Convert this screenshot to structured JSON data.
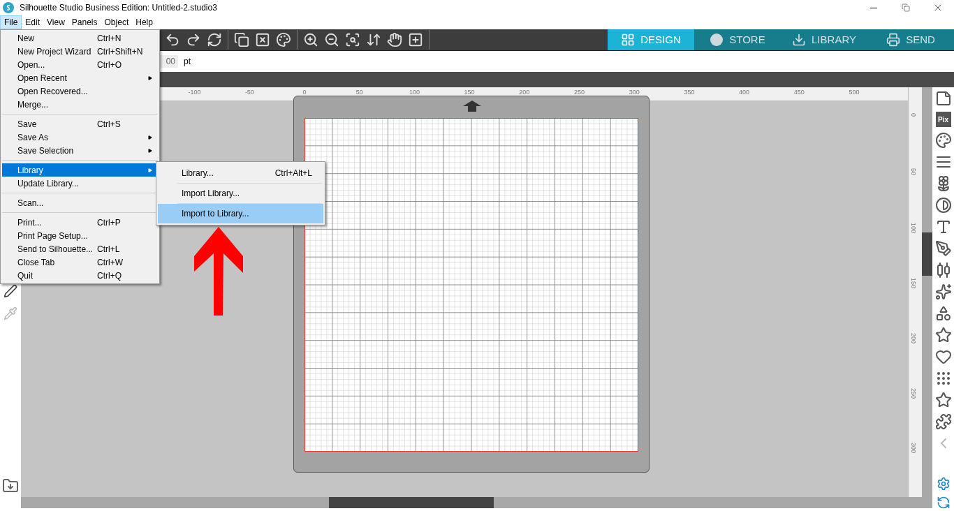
{
  "window": {
    "title": "Silhouette Studio Business Edition: Untitled-2.studio3"
  },
  "menu_bar": [
    {
      "label": "File",
      "selected": true
    },
    {
      "label": "Edit",
      "selected": false
    },
    {
      "label": "View",
      "selected": false
    },
    {
      "label": "Panels",
      "selected": false
    },
    {
      "label": "Object",
      "selected": false
    },
    {
      "label": "Help",
      "selected": false
    }
  ],
  "file_menu": [
    {
      "kind": "item",
      "label": "New",
      "shortcut": "Ctrl+N",
      "selected": false
    },
    {
      "kind": "item",
      "label": "New Project Wizard",
      "shortcut": "Ctrl+Shift+N",
      "selected": false
    },
    {
      "kind": "item",
      "label": "Open...",
      "shortcut": "Ctrl+O",
      "selected": false
    },
    {
      "kind": "submenu",
      "label": "Open Recent",
      "selected": false
    },
    {
      "kind": "item",
      "label": "Open Recovered...",
      "selected": false
    },
    {
      "kind": "item",
      "label": "Merge...",
      "selected": false
    },
    {
      "kind": "separator"
    },
    {
      "kind": "item",
      "label": "Save",
      "shortcut": "Ctrl+S",
      "selected": false
    },
    {
      "kind": "submenu",
      "label": "Save As",
      "selected": false
    },
    {
      "kind": "submenu",
      "label": "Save Selection",
      "selected": false
    },
    {
      "kind": "separator"
    },
    {
      "kind": "submenu",
      "label": "Library",
      "selected": true
    },
    {
      "kind": "item",
      "label": "Update Library...",
      "selected": false
    },
    {
      "kind": "separator"
    },
    {
      "kind": "item",
      "label": "Scan...",
      "selected": false
    },
    {
      "kind": "separator"
    },
    {
      "kind": "item",
      "label": "Print...",
      "shortcut": "Ctrl+P",
      "selected": false
    },
    {
      "kind": "item",
      "label": "Print Page Setup...",
      "selected": false
    },
    {
      "kind": "item",
      "label": "Send to Silhouette...",
      "shortcut": "Ctrl+L",
      "selected": false
    },
    {
      "kind": "item",
      "label": "Close Tab",
      "shortcut": "Ctrl+W",
      "selected": false
    },
    {
      "kind": "item",
      "label": "Quit",
      "shortcut": "Ctrl+Q",
      "selected": false
    }
  ],
  "library_submenu": [
    {
      "label": "Library...",
      "shortcut": "Ctrl+Alt+L",
      "selected": false
    },
    {
      "label": "Import Library...",
      "selected": false
    },
    {
      "label": "Import to Library...",
      "selected": true
    }
  ],
  "mode_tabs": [
    {
      "label": "DESIGN",
      "selected": true
    },
    {
      "label": "STORE",
      "selected": false
    },
    {
      "label": "LIBRARY",
      "selected": false
    },
    {
      "label": "SEND",
      "selected": false
    }
  ],
  "options_bar": {
    "value": "00",
    "unit": "pt"
  },
  "horizontal_ruler": [
    "-100",
    "-50",
    "0",
    "50",
    "100",
    "150",
    "200",
    "250",
    "300",
    "350",
    "400",
    "450",
    "500"
  ],
  "vertical_ruler": [
    "0",
    "50",
    "100",
    "150",
    "200",
    "250",
    "300"
  ],
  "side_panel": {
    "pix_label": "Pix"
  }
}
